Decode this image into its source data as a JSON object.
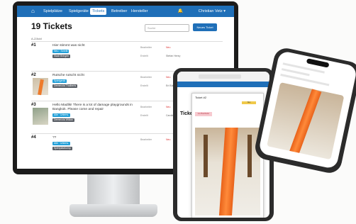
{
  "nav": {
    "items": [
      "Spielplätze",
      "Spielgeräte",
      "Tickets",
      "Betreiber",
      "Hersteller"
    ],
    "active_index": 2,
    "user": "Christian Vetz ▾"
  },
  "page": {
    "title": "19 Tickets",
    "search_placeholder": "Suche",
    "new_button": "Neues Ticket",
    "filter_label": "A-Z/Add"
  },
  "tickets": [
    {
      "num": "#1",
      "title": "Hier stimmt was nicht",
      "tags": [
        "Neu · Schritt",
        "Stadt Bringen"
      ]
    },
    {
      "num": "#2",
      "title": "Rutsche rutscht nicht",
      "tags": [
        "Spielgerät",
        "Demenzia Thalberts"
      ]
    },
    {
      "num": "#3",
      "title": "Hello Madlik! There is a lot of damage playgrounds in Bangkok. Please come and repair",
      "tags": [
        "Alle · Unterw.",
        "Demenzia Willow"
      ]
    },
    {
      "num": "#4",
      "title": "??",
      "tags": [
        "Alle · Unterw.",
        "Spielplatzkomp"
      ]
    }
  ],
  "meta_labels": {
    "status": "Bearbeiter",
    "created": "Erstellt"
  },
  "meta_values": {
    "status": "Neu",
    "t1_created": "Stefan Henry",
    "t2_created": "Eri Bürger",
    "t3_created": "Caroline"
  },
  "tablet": {
    "heading": "Ticke",
    "modal_title": "Ticket #2",
    "badge": "Neu",
    "pink_tag": "neu Bearbeiter"
  },
  "colors": {
    "nav": "#1f6fb8",
    "tag_blue": "#23a0d8",
    "tag_gray": "#5a5f66",
    "slide": "#ee7a2a"
  }
}
